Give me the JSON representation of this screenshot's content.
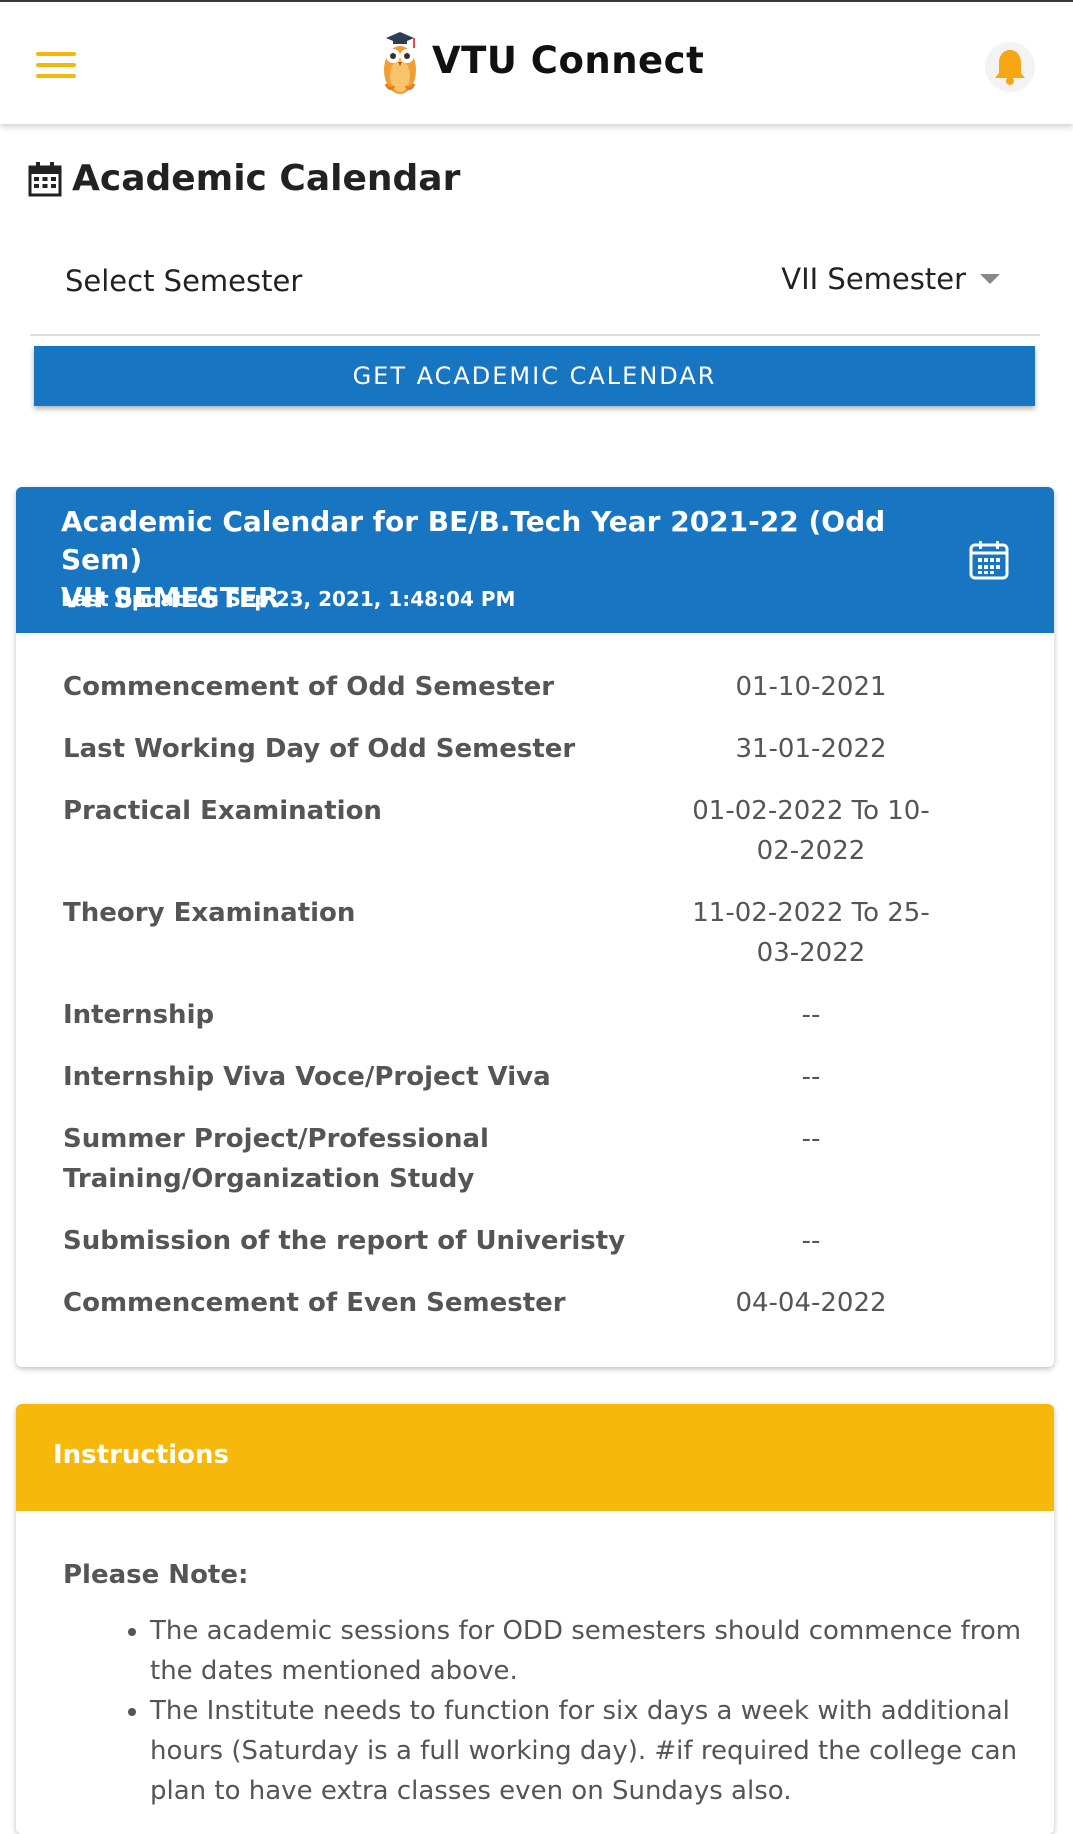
{
  "app": {
    "title": "VTU Connect"
  },
  "page": {
    "title": "Academic Calendar"
  },
  "semester_select": {
    "label": "Select Semester",
    "value": "VII Semester"
  },
  "get_button": {
    "label": "GET ACADEMIC CALENDAR"
  },
  "calendar": {
    "title_line1": "Academic Calendar for BE/B.Tech Year 2021-22 (Odd Sem)",
    "title_line2": "VII SEMESTER",
    "last_updated": "Last Updated: Sep 23, 2021, 1:48:04 PM",
    "rows": [
      {
        "label": "Commencement of Odd Semester",
        "value": "01-10-2021"
      },
      {
        "label": "Last Working Day of Odd Semester",
        "value": "31-01-2022"
      },
      {
        "label": "Practical Examination",
        "value": "01-02-2022 To 10-02-2022"
      },
      {
        "label": "Theory Examination",
        "value": "11-02-2022 To 25-03-2022"
      },
      {
        "label": "Internship",
        "value": "--"
      },
      {
        "label": "Internship Viva Voce/Project Viva",
        "value": "--"
      },
      {
        "label": "Summer Project/Professional Training/Organization Study",
        "value": "--"
      },
      {
        "label": "Submission of the report of Univeristy",
        "value": "--"
      },
      {
        "label": "Commencement of Even Semester",
        "value": "04-04-2022"
      }
    ]
  },
  "instructions": {
    "header": "Instructions",
    "note_title": "Please Note:",
    "items": [
      "The academic sessions for ODD semesters should commence from the dates mentioned above.",
      "The Institute needs to function for six days a week with additional hours (Saturday is a full working day). #if required the college can plan to have extra classes even on Sundays also."
    ]
  },
  "colors": {
    "primary_blue": "#1775c1",
    "accent_yellow": "#f6b90b",
    "menu_yellow": "#f6b70d"
  },
  "icons": {
    "menu": "hamburger-menu-icon",
    "logo": "owl-graduate-logo",
    "notification": "bell-icon",
    "page_title": "calendar-grid-icon",
    "card": "calendar-icon"
  }
}
